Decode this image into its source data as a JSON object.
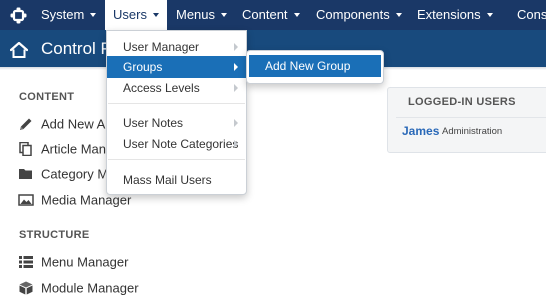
{
  "navbar": {
    "items": [
      {
        "label": "System"
      },
      {
        "label": "Users"
      },
      {
        "label": "Menus"
      },
      {
        "label": "Content"
      },
      {
        "label": "Components"
      },
      {
        "label": "Extensions"
      },
      {
        "label": "Cons"
      }
    ],
    "logo_icon": "joomla-logo-icon"
  },
  "header": {
    "title": "Control Panel",
    "home_icon": "home-icon"
  },
  "sidebar": {
    "content_title": "CONTENT",
    "content_items": [
      {
        "label": "Add New Article",
        "icon": "pencil-icon"
      },
      {
        "label": "Article Manager",
        "icon": "copy-icon"
      },
      {
        "label": "Category Manager",
        "icon": "folder-icon"
      },
      {
        "label": "Media Manager",
        "icon": "image-icon"
      }
    ],
    "structure_title": "STRUCTURE",
    "structure_items": [
      {
        "label": "Menu Manager",
        "icon": "list-icon"
      },
      {
        "label": "Module Manager",
        "icon": "cube-icon"
      }
    ]
  },
  "logged_in": {
    "title": "LOGGED-IN USERS",
    "user": "James",
    "role": "Administration"
  },
  "users_menu": {
    "items": [
      {
        "label": "User Manager"
      },
      {
        "label": "Groups"
      },
      {
        "label": "Access Levels"
      },
      {
        "label": "User Notes"
      },
      {
        "label": "User Note Categories"
      },
      {
        "label": "Mass Mail Users"
      }
    ],
    "groups_submenu": {
      "items": [
        {
          "label": "Add New Group"
        }
      ]
    }
  },
  "colors": {
    "navbar_bg": "#1a3867",
    "header_bg": "#184a7d",
    "menu_highlight": "#1a6fb7",
    "link_blue": "#2a69b8"
  }
}
